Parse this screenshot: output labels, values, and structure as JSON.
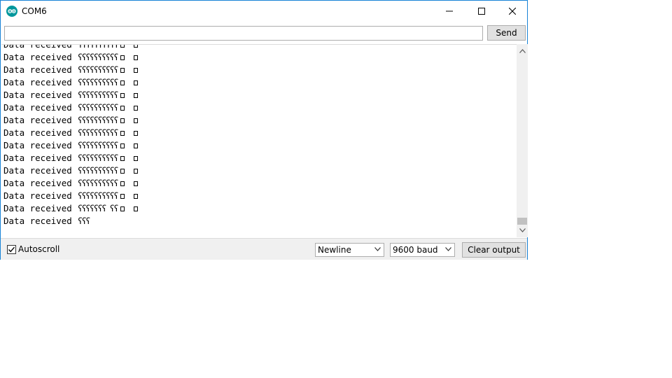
{
  "window": {
    "title": "COM6"
  },
  "send": {
    "input_value": "",
    "button_label": "Send"
  },
  "output": {
    "lines": [
      {
        "label": "Data received",
        "data": "ʕʕʕʕʕʕʕʕʕʕ"
      },
      {
        "label": "Data received",
        "data": "ʕʕʕʕʕʕʕʕʕʕ"
      },
      {
        "label": "Data received",
        "data": "ʕʕʕʕʕʕʕʕʕʕ"
      },
      {
        "label": "Data received",
        "data": "ʕʕʕʕʕʕʕʕʕʕ"
      },
      {
        "label": "Data received",
        "data": "ʕʕʕʕʕʕʕʕʕʕ"
      },
      {
        "label": "Data received",
        "data": "ʕʕʕʕʕʕʕʕʕʕ"
      },
      {
        "label": "Data received",
        "data": "ʕʕʕʕʕʕʕʕʕʕ"
      },
      {
        "label": "Data received",
        "data": "ʕʕʕʕʕʕʕʕʕʕ"
      },
      {
        "label": "Data received",
        "data": "ʕʕʕʕʕʕʕʕʕʕ"
      },
      {
        "label": "Data received",
        "data": "ʕʕʕʕʕʕʕʕʕʕ"
      },
      {
        "label": "Data received",
        "data": "ʕʕʕʕʕʕʕʕʕʕ"
      },
      {
        "label": "Data received",
        "data": "ʕʕʕʕʕʕʕʕʕʕ"
      },
      {
        "label": "Data received",
        "data": "ʕʕʕʕʕʕʕʕʕʕ"
      },
      {
        "label": "Data received",
        "data": "ʕʕʕʕʕʕʕ ʕʕ"
      },
      {
        "label": "Data received",
        "data": "ʕʕʕ"
      }
    ]
  },
  "footer": {
    "autoscroll_label": "Autoscroll",
    "autoscroll_checked": true,
    "line_ending": "Newline",
    "baud_rate": "9600 baud",
    "clear_label": "Clear output"
  },
  "colors": {
    "window_border": "#1883d7",
    "app_icon": "#00979c",
    "statusbar": "#f0f0f0",
    "button": "#e1e1e1"
  }
}
